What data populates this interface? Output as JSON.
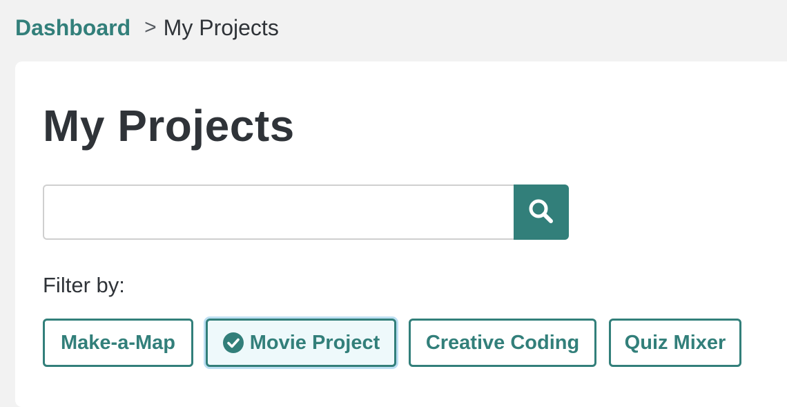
{
  "breadcrumb": {
    "root": "Dashboard",
    "separator": ">",
    "current": "My Projects"
  },
  "page": {
    "title": "My Projects"
  },
  "search": {
    "placeholder": "",
    "value": "",
    "button_icon": "search-icon"
  },
  "filters": {
    "label": "Filter by:",
    "chips": [
      {
        "label": "Make-a-Map",
        "selected": false
      },
      {
        "label": "Movie Project",
        "selected": true,
        "icon": "check-circle-icon"
      },
      {
        "label": "Creative Coding",
        "selected": false
      },
      {
        "label": "Quiz Mixer",
        "selected": false
      }
    ]
  },
  "colors": {
    "accent": "#327f7a",
    "background": "#f2f2f2",
    "card": "#ffffff",
    "text": "#2f3338",
    "selected_chip_bg": "#eef9fb",
    "selected_chip_ring": "#bcdff2"
  }
}
